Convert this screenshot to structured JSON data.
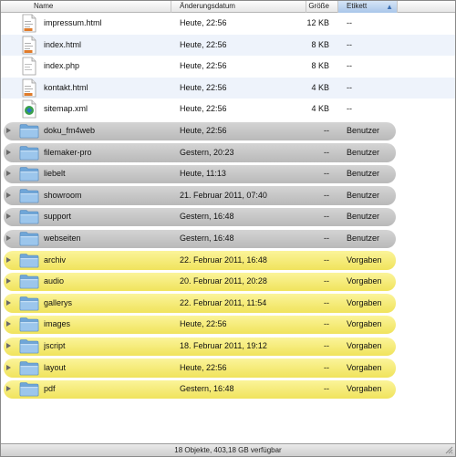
{
  "columns": {
    "name": "Name",
    "date": "Änderungsdatum",
    "size": "Größe",
    "label": "Etikett"
  },
  "colors": {
    "gray_label": "#c4c4c4",
    "yellow_label": "#f5ea6e",
    "selected_column": "#b7d0ee",
    "alt_row": "#eef3fb",
    "folder_blue": "#7fb2e0"
  },
  "rows": [
    {
      "kind": "file",
      "icon": "html-file-icon",
      "name": "impressum.html",
      "date": "Heute, 22:56",
      "size": "12 KB",
      "label": "--",
      "color": "none"
    },
    {
      "kind": "file",
      "icon": "html-file-icon",
      "name": "index.html",
      "date": "Heute, 22:56",
      "size": "8 KB",
      "label": "--",
      "color": "none"
    },
    {
      "kind": "file",
      "icon": "php-file-icon",
      "name": "index.php",
      "date": "Heute, 22:56",
      "size": "8 KB",
      "label": "--",
      "color": "none"
    },
    {
      "kind": "file",
      "icon": "html-file-icon",
      "name": "kontakt.html",
      "date": "Heute, 22:56",
      "size": "4 KB",
      "label": "--",
      "color": "none"
    },
    {
      "kind": "file",
      "icon": "xml-file-icon",
      "name": "sitemap.xml",
      "date": "Heute, 22:56",
      "size": "4 KB",
      "label": "--",
      "color": "none"
    },
    {
      "kind": "folder",
      "icon": "folder-icon",
      "name": "doku_fm4web",
      "date": "Heute, 22:56",
      "size": "--",
      "label": "Benutzer",
      "color": "gray"
    },
    {
      "kind": "folder",
      "icon": "folder-icon",
      "name": "filemaker-pro",
      "date": "Gestern, 20:23",
      "size": "--",
      "label": "Benutzer",
      "color": "gray"
    },
    {
      "kind": "folder",
      "icon": "folder-icon",
      "name": "liebelt",
      "date": "Heute, 11:13",
      "size": "--",
      "label": "Benutzer",
      "color": "gray"
    },
    {
      "kind": "folder",
      "icon": "folder-icon",
      "name": "showroom",
      "date": "21. Februar 2011, 07:40",
      "size": "--",
      "label": "Benutzer",
      "color": "gray"
    },
    {
      "kind": "folder",
      "icon": "folder-icon",
      "name": "support",
      "date": "Gestern, 16:48",
      "size": "--",
      "label": "Benutzer",
      "color": "gray"
    },
    {
      "kind": "folder",
      "icon": "folder-icon",
      "name": "webseiten",
      "date": "Gestern, 16:48",
      "size": "--",
      "label": "Benutzer",
      "color": "gray"
    },
    {
      "kind": "folder",
      "icon": "folder-icon",
      "name": "archiv",
      "date": "22. Februar 2011, 16:48",
      "size": "--",
      "label": "Vorgaben",
      "color": "yellow"
    },
    {
      "kind": "folder",
      "icon": "folder-icon",
      "name": "audio",
      "date": "20. Februar 2011, 20:28",
      "size": "--",
      "label": "Vorgaben",
      "color": "yellow"
    },
    {
      "kind": "folder",
      "icon": "folder-icon",
      "name": "gallerys",
      "date": "22. Februar 2011, 11:54",
      "size": "--",
      "label": "Vorgaben",
      "color": "yellow"
    },
    {
      "kind": "folder",
      "icon": "folder-icon",
      "name": "images",
      "date": "Heute, 22:56",
      "size": "--",
      "label": "Vorgaben",
      "color": "yellow"
    },
    {
      "kind": "folder",
      "icon": "folder-icon",
      "name": "jscript",
      "date": "18. Februar 2011, 19:12",
      "size": "--",
      "label": "Vorgaben",
      "color": "yellow"
    },
    {
      "kind": "folder",
      "icon": "folder-icon",
      "name": "layout",
      "date": "Heute, 22:56",
      "size": "--",
      "label": "Vorgaben",
      "color": "yellow"
    },
    {
      "kind": "folder",
      "icon": "folder-icon",
      "name": "pdf",
      "date": "Gestern, 16:48",
      "size": "--",
      "label": "Vorgaben",
      "color": "yellow"
    }
  ],
  "status": "18 Objekte, 403,18 GB verfügbar"
}
